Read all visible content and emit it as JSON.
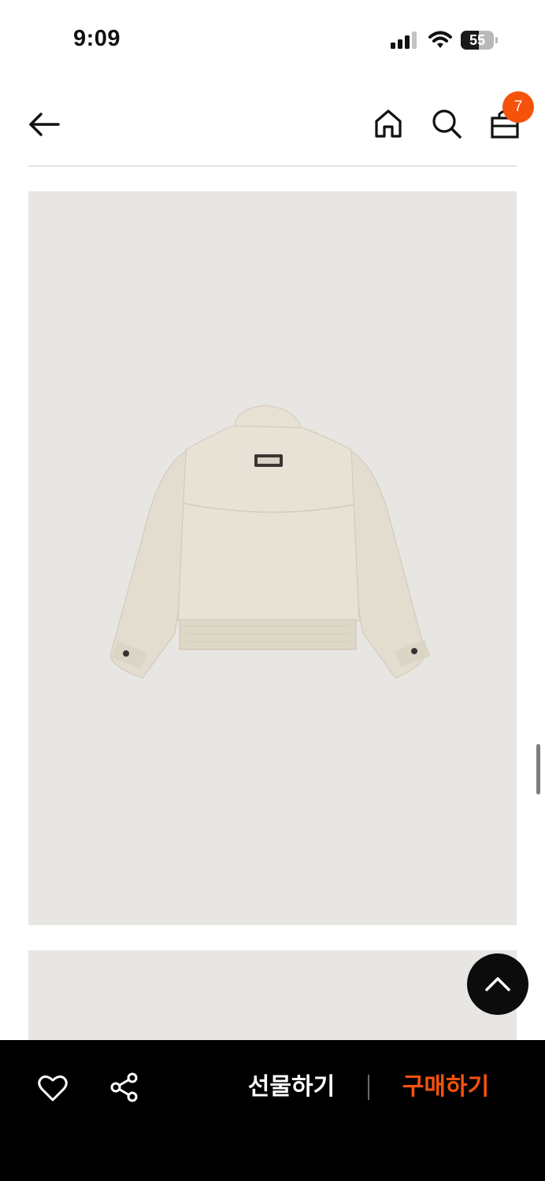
{
  "status_bar": {
    "time": "9:09",
    "battery_level": "55",
    "icons": [
      "signal-icon",
      "wifi-icon",
      "battery-icon"
    ]
  },
  "nav": {
    "icons": [
      "back-arrow-icon",
      "home-icon",
      "search-icon",
      "shopping-bag-icon"
    ],
    "cart_count": "7",
    "badge_color": "#f5520c"
  },
  "product": {
    "image_subject": "cream jacket back view",
    "image_bg": "#e8e6e3"
  },
  "floating": {
    "icon": "chevron-up-icon"
  },
  "bottom_bar": {
    "icons": [
      "heart-icon",
      "share-icon"
    ],
    "gift_label": "선물하기",
    "buy_label": "구매하기",
    "buy_color": "#f5520c"
  }
}
